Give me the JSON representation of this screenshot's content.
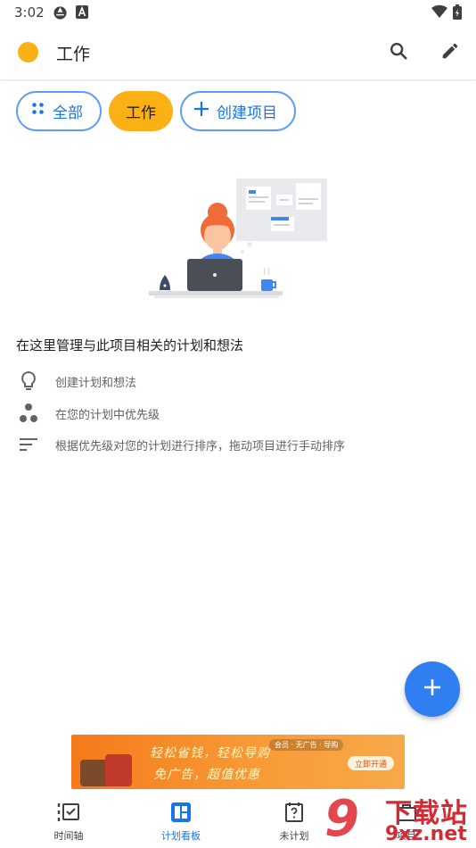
{
  "status_bar": {
    "time": "3:02",
    "icons": [
      "vpn-key-icon",
      "a-badge-icon",
      "wifi-icon",
      "battery-icon"
    ]
  },
  "app_bar": {
    "title": "工作",
    "project_color": "#fbb016",
    "actions": [
      "search-icon",
      "edit-icon"
    ]
  },
  "filter_chips": {
    "all": "全部",
    "work": "工作",
    "create": "创建项目"
  },
  "empty_state": {
    "headline": "在这里管理与此项目相关的计划和想法",
    "tips": [
      {
        "icon": "lightbulb-icon",
        "text": "创建计划和想法"
      },
      {
        "icon": "priority-dots-icon",
        "text": "在您的计划中优先级"
      },
      {
        "icon": "sort-lines-icon",
        "text": "根据优先级对您的计划进行排序，拖动项目进行手动排序"
      }
    ]
  },
  "ad": {
    "line1": "轻松省钱，轻松导购",
    "line2": "免广告，超值优惠",
    "tag": "会员 · 无广告 · 导购",
    "cta": "立即开通"
  },
  "bottom_nav": {
    "items": [
      {
        "icon": "timeline-icon",
        "label": "时间轴"
      },
      {
        "icon": "board-icon",
        "label": "计划看板"
      },
      {
        "icon": "unplanned-calendar-icon",
        "label": "未计划"
      },
      {
        "icon": "briefcase-icon",
        "label": "项目"
      }
    ],
    "active_index": 1
  },
  "watermark": {
    "brand": "下载站",
    "domain": "9xz.net",
    "mark": "9"
  },
  "colors": {
    "accent": "#1a73e8",
    "chip_outline": "#5c9df5",
    "work_color": "#fbb016",
    "fab": "#2f7ff0"
  }
}
